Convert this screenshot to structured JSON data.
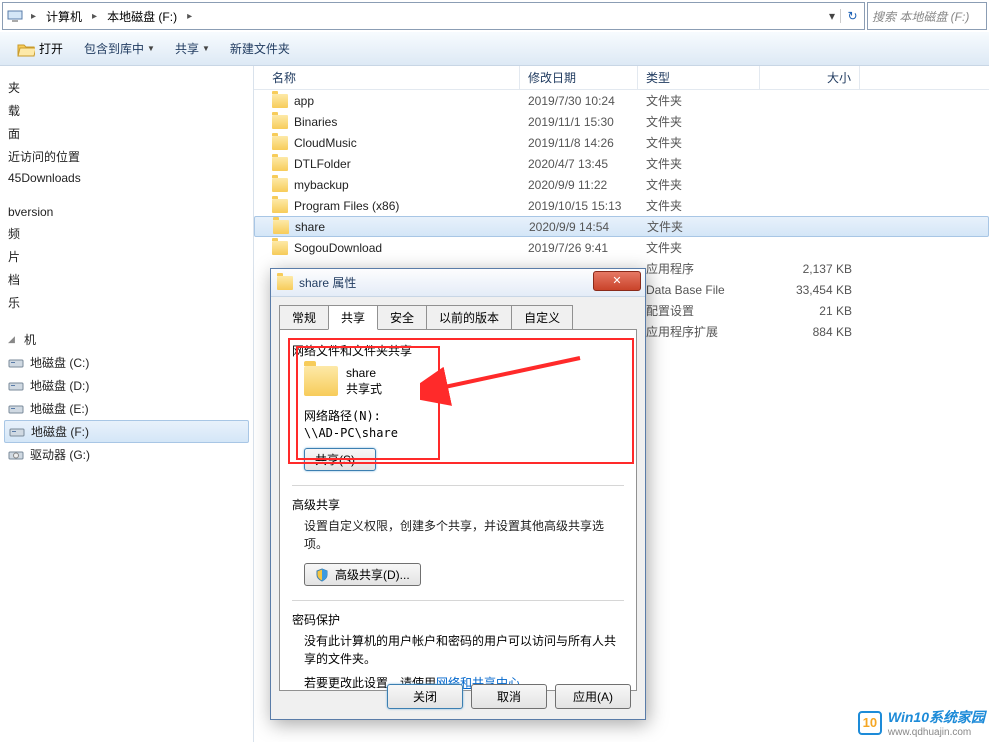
{
  "breadcrumb": {
    "computer": "计算机",
    "drive": "本地磁盘 (F:)"
  },
  "search": {
    "placeholder": "搜索 本地磁盘 (F:)"
  },
  "toolbar": {
    "open": "打开",
    "include": "包含到库中",
    "share": "共享",
    "newfolder": "新建文件夹"
  },
  "sidebar": {
    "items": [
      "夹",
      "载",
      "面",
      "近访问的位置",
      "45Downloads"
    ],
    "group2": [
      "bversion",
      "频",
      "片",
      "档",
      "乐"
    ],
    "group3_label": "机",
    "group3": [
      "地磁盘 (C:)",
      "地磁盘 (D:)",
      "地磁盘 (E:)",
      "地磁盘 (F:)",
      "驱动器 (G:)"
    ],
    "selected_drive": "地磁盘 (F:)"
  },
  "columns": {
    "name": "名称",
    "date": "修改日期",
    "type": "类型",
    "size": "大小"
  },
  "files": [
    {
      "name": "app",
      "date": "2019/7/30 10:24",
      "type": "文件夹",
      "size": ""
    },
    {
      "name": "Binaries",
      "date": "2019/11/1 15:30",
      "type": "文件夹",
      "size": ""
    },
    {
      "name": "CloudMusic",
      "date": "2019/11/8 14:26",
      "type": "文件夹",
      "size": ""
    },
    {
      "name": "DTLFolder",
      "date": "2020/4/7 13:45",
      "type": "文件夹",
      "size": ""
    },
    {
      "name": "mybackup",
      "date": "2020/9/9 11:22",
      "type": "文件夹",
      "size": ""
    },
    {
      "name": "Program Files (x86)",
      "date": "2019/10/15 15:13",
      "type": "文件夹",
      "size": ""
    },
    {
      "name": "share",
      "date": "2020/9/9 14:54",
      "type": "文件夹",
      "size": "",
      "selected": true
    },
    {
      "name": "SogouDownload",
      "date": "2019/7/26 9:41",
      "type": "文件夹",
      "size": ""
    },
    {
      "name": "",
      "date": "",
      "type": "应用程序",
      "size": "2,137 KB"
    },
    {
      "name": "",
      "date": "",
      "type": "Data Base File",
      "size": "33,454 KB"
    },
    {
      "name": "",
      "date": "",
      "type": "配置设置",
      "size": "21 KB"
    },
    {
      "name": "",
      "date": "",
      "type": "应用程序扩展",
      "size": "884 KB"
    }
  ],
  "dialog": {
    "title": "share 属性",
    "tabs": [
      "常规",
      "共享",
      "安全",
      "以前的版本",
      "自定义"
    ],
    "active_tab": "共享",
    "section1_label": "网络文件和文件夹共享",
    "folder_name": "share",
    "folder_status": "共享式",
    "net_path_label": "网络路径(N):",
    "net_path": "\\\\AD-PC\\share",
    "share_btn": "共享(S)...",
    "section2_label": "高级共享",
    "section2_desc": "设置自定义权限，创建多个共享，并设置其他高级共享选项。",
    "adv_btn": "高级共享(D)...",
    "section3_label": "密码保护",
    "section3_desc1": "没有此计算机的用户帐户和密码的用户可以访问与所有人共享的文件夹。",
    "section3_desc2_prefix": "若要更改此设置，请使用",
    "section3_link": "网络和共享中心",
    "section3_desc2_suffix": "。",
    "btn_close": "关闭",
    "btn_cancel": "取消",
    "btn_apply": "应用(A)"
  },
  "watermark": {
    "line1": "Win10系统家园",
    "line2": "www.qdhuajin.com",
    "logo": "10"
  }
}
